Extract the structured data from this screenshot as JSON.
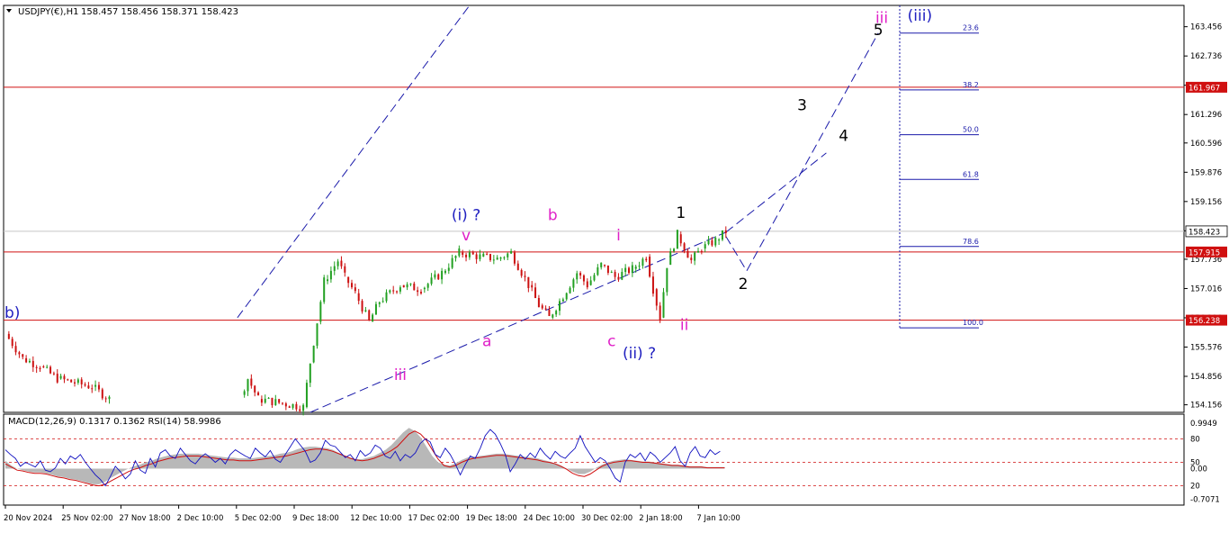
{
  "header": {
    "symbol": "USDJPY(€),H1",
    "ohlc": "158.457 158.456 158.371 158.423",
    "menu_icon": "triangle-down-icon"
  },
  "colors": {
    "up_candle": "#22a022",
    "down_candle": "#cc1111",
    "channel": "#1a1aaa",
    "hline": "#d01010",
    "wave_magenta": "#e020c8",
    "wave_blue": "#2020c0",
    "wave_black": "#000000",
    "macd_hist": "#b8b8b8",
    "macd_signal": "#d01010",
    "rsi": "#1010c0"
  },
  "chart_data": [
    {
      "type": "candlestick",
      "title": "USDJPY(€),H1",
      "y_ticks": [
        "163.456",
        "162.736",
        "162.016",
        "161.296",
        "160.596",
        "159.876",
        "159.156",
        "158.436",
        "157.736",
        "157.016",
        "156.296",
        "155.576",
        "154.856",
        "154.156"
      ],
      "ylim": [
        153.97,
        163.98
      ],
      "x_ticks": [
        "20 Nov 2024",
        "25 Nov 02:00",
        "27 Nov 18:00",
        "2 Dec 10:00",
        "5 Dec 02:00",
        "9 Dec 18:00",
        "12 Dec 10:00",
        "17 Dec 02:00",
        "19 Dec 18:00",
        "24 Dec 10:00",
        "30 Dec 02:00",
        "2 Jan 18:00",
        "7 Jan 10:00"
      ],
      "current_price": "158.423",
      "horizontal_levels": [
        {
          "price": 161.967,
          "label": "161.967"
        },
        {
          "price": 157.915,
          "label": "157.915"
        },
        {
          "price": 156.238,
          "label": "156.238"
        }
      ],
      "fibonacci_levels": [
        {
          "label": "23.6",
          "price": 163.3
        },
        {
          "label": "38.2",
          "price": 161.9
        },
        {
          "label": "50.0",
          "price": 160.8
        },
        {
          "label": "61.8",
          "price": 159.7
        },
        {
          "label": "78.6",
          "price": 158.05
        },
        {
          "label": "100.0",
          "price": 156.05
        }
      ],
      "price_path": [
        [
          0,
          155.9
        ],
        [
          0.5,
          155.3
        ],
        [
          1,
          155.1
        ],
        [
          1.5,
          154.8
        ],
        [
          2,
          154.7
        ],
        [
          2.5,
          154.6
        ],
        [
          3,
          154.3
        ],
        [
          6.8,
          154.4
        ],
        [
          7,
          154.8
        ],
        [
          7.3,
          154.3
        ],
        [
          8.6,
          154.1
        ],
        [
          8.8,
          155.2
        ],
        [
          9,
          156.2
        ],
        [
          9.2,
          157.2
        ],
        [
          9.6,
          157.7
        ],
        [
          9.8,
          157.3
        ],
        [
          10.1,
          156.9
        ],
        [
          10.5,
          156.2
        ],
        [
          10.8,
          156.7
        ],
        [
          11.4,
          157.1
        ],
        [
          12,
          157.0
        ],
        [
          12.6,
          157.4
        ],
        [
          13.1,
          157.9
        ],
        [
          13.7,
          157.8
        ],
        [
          14.2,
          157.75
        ],
        [
          14.6,
          157.9
        ],
        [
          15.1,
          157.1
        ],
        [
          15.4,
          156.6
        ],
        [
          15.7,
          156.3
        ],
        [
          16,
          156.7
        ],
        [
          16.5,
          157.4
        ],
        [
          16.8,
          157.1
        ],
        [
          17.2,
          157.6
        ],
        [
          17.6,
          157.3
        ],
        [
          18.1,
          157.5
        ],
        [
          18.5,
          157.8
        ],
        [
          18.7,
          157.0
        ],
        [
          18.9,
          156.3
        ],
        [
          19.1,
          157.6
        ],
        [
          19.4,
          158.35
        ],
        [
          19.8,
          157.7
        ],
        [
          20.1,
          158.0
        ],
        [
          20.5,
          158.2
        ],
        [
          20.8,
          158.42
        ]
      ],
      "channel_lines": [
        [
          [
            6.7,
            156.3
          ],
          [
            13.4,
            163.98
          ]
        ],
        [
          [
            8.8,
            153.97
          ],
          [
            20.8,
            158.4
          ]
        ],
        [
          [
            20.8,
            158.4
          ],
          [
            23.7,
            160.35
          ]
        ],
        [
          [
            20.8,
            158.3
          ],
          [
            21.4,
            157.45
          ],
          [
            25.2,
            163.3
          ]
        ]
      ],
      "wave_labels": [
        {
          "text": "iii",
          "x": 25.3,
          "price": 163.55,
          "color": "magenta"
        },
        {
          "text": "(iii)",
          "x": 26.4,
          "price": 163.6,
          "color": "blue"
        },
        {
          "text": "5",
          "x": 25.2,
          "price": 163.25,
          "color": "black"
        },
        {
          "text": "3",
          "x": 23.0,
          "price": 161.4,
          "color": "black"
        },
        {
          "text": "4",
          "x": 24.2,
          "price": 160.65,
          "color": "black"
        },
        {
          "text": "(i) ?",
          "x": 13.3,
          "price": 158.7,
          "color": "blue"
        },
        {
          "text": "v",
          "x": 13.3,
          "price": 158.2,
          "color": "magenta"
        },
        {
          "text": "b",
          "x": 15.8,
          "price": 158.7,
          "color": "magenta"
        },
        {
          "text": "i",
          "x": 17.7,
          "price": 158.2,
          "color": "magenta"
        },
        {
          "text": "1",
          "x": 19.5,
          "price": 158.75,
          "color": "black"
        },
        {
          "text": "2",
          "x": 21.3,
          "price": 157.0,
          "color": "black"
        },
        {
          "text": "ii",
          "x": 19.6,
          "price": 156.0,
          "color": "magenta"
        },
        {
          "text": "a",
          "x": 13.9,
          "price": 155.6,
          "color": "magenta"
        },
        {
          "text": "c",
          "x": 17.5,
          "price": 155.6,
          "color": "magenta"
        },
        {
          "text": "(ii) ?",
          "x": 18.3,
          "price": 155.3,
          "color": "blue"
        },
        {
          "text": "iii",
          "x": 11.4,
          "price": 154.77,
          "color": "magenta"
        },
        {
          "text": "b)",
          "x": 0.2,
          "price": 156.3,
          "color": "blue"
        }
      ]
    },
    {
      "type": "line",
      "title": "MACD(12,26,9) 0.1317 0.1362  RSI(14) 58.9986",
      "y_ticks": [
        "0.9949",
        "80",
        "50",
        "0.00",
        "20",
        "-0.7071"
      ],
      "ylim": [
        0,
        100
      ],
      "levels": [
        80,
        50,
        20
      ],
      "series": [
        {
          "name": "RSI(14)",
          "values": [
            66,
            60,
            55,
            45,
            50,
            47,
            44,
            52,
            40,
            38,
            43,
            55,
            48,
            58,
            54,
            60,
            50,
            42,
            34,
            28,
            20,
            32,
            45,
            38,
            29,
            35,
            52,
            40,
            36,
            55,
            44,
            62,
            66,
            58,
            55,
            68,
            60,
            52,
            48,
            56,
            61,
            56,
            50,
            55,
            48,
            60,
            66,
            62,
            58,
            55,
            68,
            62,
            57,
            65,
            54,
            50,
            60,
            70,
            80,
            72,
            64,
            50,
            53,
            62,
            78,
            72,
            70,
            63,
            56,
            60,
            52,
            65,
            58,
            62,
            72,
            68,
            58,
            55,
            64,
            52,
            60,
            56,
            62,
            74,
            80,
            76,
            60,
            56,
            68,
            60,
            48,
            34,
            47,
            58,
            55,
            68,
            84,
            92,
            86,
            74,
            60,
            38,
            48,
            60,
            54,
            62,
            56,
            68,
            60,
            54,
            64,
            58,
            55,
            62,
            68,
            84,
            70,
            60,
            50,
            56,
            52,
            42,
            30,
            25,
            50,
            60,
            56,
            62,
            52,
            63,
            58,
            50,
            56,
            62,
            70,
            52,
            45,
            62,
            70,
            58,
            56,
            66,
            60,
            64
          ]
        },
        {
          "name": "MACD signal",
          "values": [
            48,
            44,
            40,
            39,
            37,
            36,
            36,
            35,
            33,
            31,
            30,
            28,
            27,
            25,
            23,
            21,
            20,
            22,
            26,
            30,
            34,
            38,
            41,
            43,
            46,
            48,
            51,
            53,
            55,
            56,
            57,
            58,
            58,
            58,
            57,
            56,
            55,
            54,
            53,
            53,
            52,
            52,
            52,
            53,
            54,
            55,
            56,
            57,
            58,
            60,
            62,
            64,
            66,
            67,
            67,
            66,
            64,
            61,
            58,
            55,
            53,
            52,
            53,
            55,
            58,
            61,
            65,
            70,
            78,
            86,
            90,
            86,
            78,
            66,
            54,
            46,
            44,
            46,
            50,
            53,
            55,
            56,
            57,
            58,
            59,
            59,
            58,
            57,
            56,
            55,
            54,
            53,
            51,
            50,
            48,
            45,
            41,
            36,
            33,
            32,
            35,
            40,
            45,
            48,
            50,
            51,
            52,
            52,
            51,
            50,
            50,
            49,
            48,
            47,
            46,
            46,
            45,
            44,
            44,
            44,
            43,
            43,
            43,
            43
          ]
        },
        {
          "name": "MACD histogram",
          "values": [
            52,
            46,
            42,
            40,
            38,
            37,
            37,
            36,
            34,
            32,
            31,
            29,
            28,
            26,
            24,
            22,
            22,
            25,
            30,
            34,
            38,
            42,
            45,
            47,
            50,
            52,
            55,
            57,
            59,
            60,
            61,
            61,
            61,
            61,
            60,
            59,
            58,
            57,
            56,
            56,
            55,
            55,
            55,
            56,
            57,
            58,
            59,
            61,
            62,
            64,
            67,
            69,
            70,
            70,
            69,
            68,
            66,
            62,
            59,
            56,
            54,
            54,
            56,
            58,
            62,
            66,
            72,
            80,
            88,
            94,
            90,
            82,
            70,
            58,
            50,
            47,
            46,
            49,
            53,
            56,
            57,
            58,
            59,
            60,
            61,
            61,
            60,
            59,
            58,
            57,
            56,
            55,
            53,
            51,
            49,
            46,
            42,
            38,
            35,
            35,
            38,
            43,
            47,
            50,
            52,
            53,
            54,
            53,
            52,
            51,
            51,
            50,
            49,
            48,
            47,
            47,
            46,
            45,
            45,
            45,
            44,
            44,
            44,
            44
          ]
        }
      ]
    }
  ]
}
